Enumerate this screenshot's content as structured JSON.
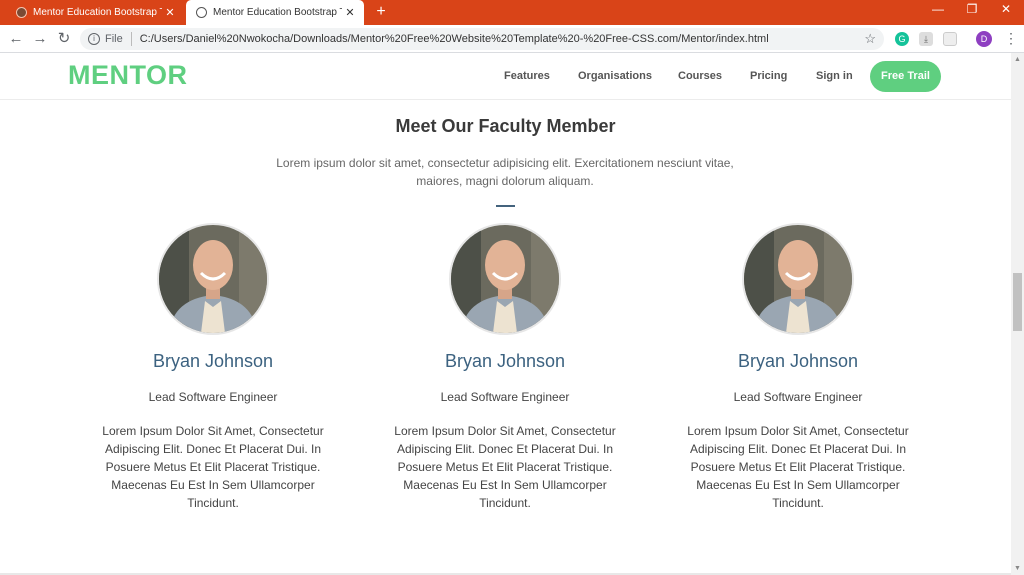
{
  "browser": {
    "tabs": [
      {
        "title": "Mentor Education Bootstrap The",
        "active": false
      },
      {
        "title": "Mentor Education Bootstrap The",
        "active": true
      }
    ],
    "address_chip": "File",
    "url": "C:/Users/Daniel%20Nwokocha/Downloads/Mentor%20Free%20Website%20Template%20-%20Free-CSS.com/Mentor/index.html",
    "profile_initial": "D",
    "accent": "#d94418"
  },
  "site": {
    "logo": "MENTOR",
    "nav": [
      "Features",
      "Organisations",
      "Courses",
      "Pricing",
      "Sign in"
    ],
    "cta": "Free Trail",
    "brand_color": "#5fcf80"
  },
  "faculty": {
    "title": "Meet Our Faculty Member",
    "subtitle": "Lorem ipsum dolor sit amet, consectetur adipisicing elit. Exercitationem nesciunt vitae, maiores, magni dolorum aliquam.",
    "members": [
      {
        "name": "Bryan Johnson",
        "role": "Lead Software Engineer",
        "bio": "Lorem Ipsum Dolor Sit Amet, Consectetur Adipiscing Elit. Donec Et Placerat Dui. In Posuere Metus Et Elit Placerat Tristique. Maecenas Eu Est In Sem Ullamcorper Tincidunt."
      },
      {
        "name": "Bryan Johnson",
        "role": "Lead Software Engineer",
        "bio": "Lorem Ipsum Dolor Sit Amet, Consectetur Adipiscing Elit. Donec Et Placerat Dui. In Posuere Metus Et Elit Placerat Tristique. Maecenas Eu Est In Sem Ullamcorper Tincidunt."
      },
      {
        "name": "Bryan Johnson",
        "role": "Lead Software Engineer",
        "bio": "Lorem Ipsum Dolor Sit Amet, Consectetur Adipiscing Elit. Donec Et Placerat Dui. In Posuere Metus Et Elit Placerat Tristique. Maecenas Eu Est In Sem Ullamcorper Tincidunt."
      }
    ]
  }
}
